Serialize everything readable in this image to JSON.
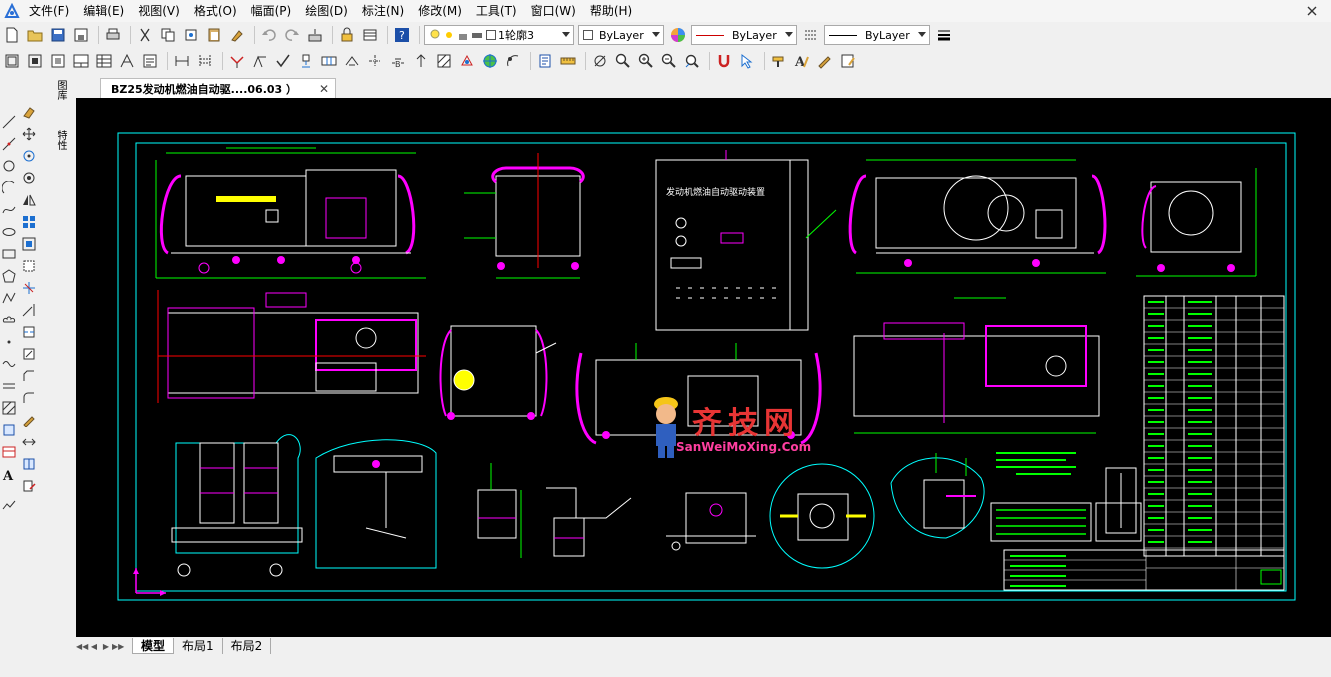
{
  "menubar": {
    "items": [
      "文件(F)",
      "编辑(E)",
      "视图(V)",
      "格式(O)",
      "幅面(P)",
      "绘图(D)",
      "标注(N)",
      "修改(M)",
      "工具(T)",
      "窗口(W)",
      "帮助(H)"
    ]
  },
  "toolbar1": {
    "layer_value": "1轮廓3",
    "color_value": "ByLayer",
    "linetype_value": "ByLayer",
    "lineweight_value": "ByLayer"
  },
  "document": {
    "tab_title": "BZ25发动机燃油自动驱....06.03 ）"
  },
  "side_palette": {
    "label1": "图库",
    "label2": "特性"
  },
  "layout_tabs": [
    "模型",
    "布局1",
    "布局2"
  ],
  "watermark": {
    "text": "齐技网",
    "subtext": "SanWeiMoXing.Com"
  },
  "drawing": {
    "title_block_text": "发动机燃油自动驱动装置",
    "colors": {
      "background": "#000000",
      "border": "#00ffff",
      "geometry": "#ffffff",
      "dimension": "#00ff00",
      "handle": "#ff00ff",
      "center": "#ff0000",
      "highlight": "#ffff00"
    }
  }
}
